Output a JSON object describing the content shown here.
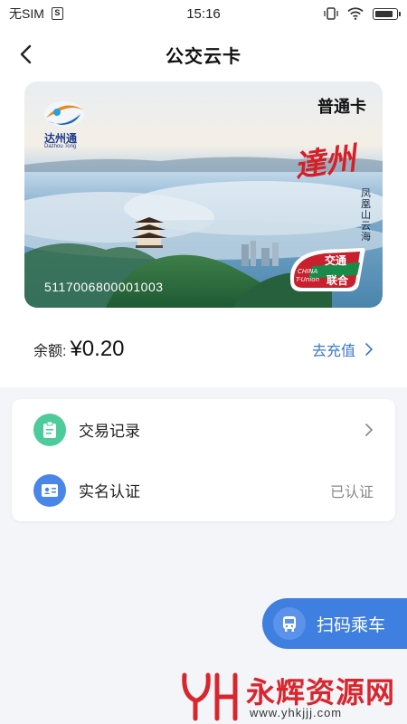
{
  "status_bar": {
    "carrier": "无SIM",
    "time": "15:16",
    "battery_level": 0.92
  },
  "header": {
    "title": "公交云卡"
  },
  "card": {
    "logo_text": "达州通",
    "logo_subtext": "Dazhou Tong",
    "type": "普通卡",
    "city_text": "達州",
    "scenic_text": "凤凰山云海",
    "number": "5117006800001003",
    "tunion_cn": "交通联合",
    "tunion_en": "CHINA T-Union"
  },
  "balance": {
    "label": "余额:",
    "amount": "¥0.20",
    "recharge_label": "去充值"
  },
  "menu": {
    "items": [
      {
        "label": "交易记录",
        "icon": "clipboard-icon",
        "color": "#4ecb9a",
        "right": ""
      },
      {
        "label": "实名认证",
        "icon": "id-card-icon",
        "color": "#4a86e8",
        "right": "已认证"
      }
    ]
  },
  "scan_button": {
    "label": "扫码乘车"
  },
  "watermark": {
    "name": "永辉资源网",
    "url": "www.yhkjjj.com"
  },
  "colors": {
    "accent": "#3f7fe0",
    "link": "#3a78c9",
    "red": "#d61f26"
  }
}
